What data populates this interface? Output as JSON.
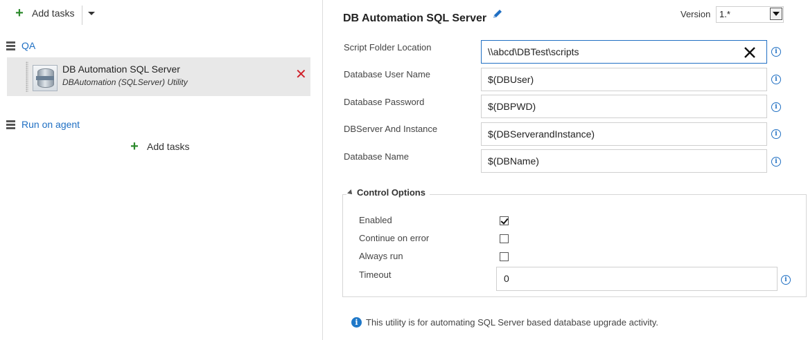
{
  "toolbar": {
    "add_tasks_label": "Add tasks"
  },
  "phases": [
    {
      "label": "QA"
    },
    {
      "label": "Run on agent"
    }
  ],
  "task": {
    "title": "DB Automation SQL Server",
    "subtitle": "DBAutomation (SQLServer) Utility"
  },
  "add_tasks_center_label": "Add tasks",
  "detail": {
    "heading": "DB Automation SQL Server",
    "version_label": "Version",
    "version_value": "1.*",
    "fields": [
      {
        "label": "Script Folder Location",
        "value": "\\\\abcd\\DBTest\\scripts"
      },
      {
        "label": "Database User Name",
        "value": "$(DBUser)"
      },
      {
        "label": "Database Password",
        "value": "$(DBPWD)"
      },
      {
        "label": "DBServer And Instance",
        "value": "$(DBServerandInstance)"
      },
      {
        "label": "Database Name",
        "value": "$(DBName)"
      }
    ],
    "control_options": {
      "title": "Control Options",
      "enabled_label": "Enabled",
      "enabled": true,
      "continue_on_error_label": "Continue on error",
      "continue_on_error": false,
      "always_run_label": "Always run",
      "always_run": false,
      "timeout_label": "Timeout",
      "timeout_value": "0"
    },
    "footnote": "This utility is for automating SQL Server based database upgrade activity."
  },
  "colors": {
    "link_blue": "#1f6fc3",
    "add_green": "#2c8a2c",
    "delete_red": "#d0202a",
    "selected_row_bg": "#e8e8e8"
  },
  "icons": {
    "add": "plus-icon",
    "dropdown": "caret-down-icon",
    "phase": "server-stack-icon",
    "task": "database-icon",
    "delete": "delete-x-icon",
    "edit": "pencil-icon",
    "clear": "clear-x-icon",
    "info": "info-icon"
  }
}
